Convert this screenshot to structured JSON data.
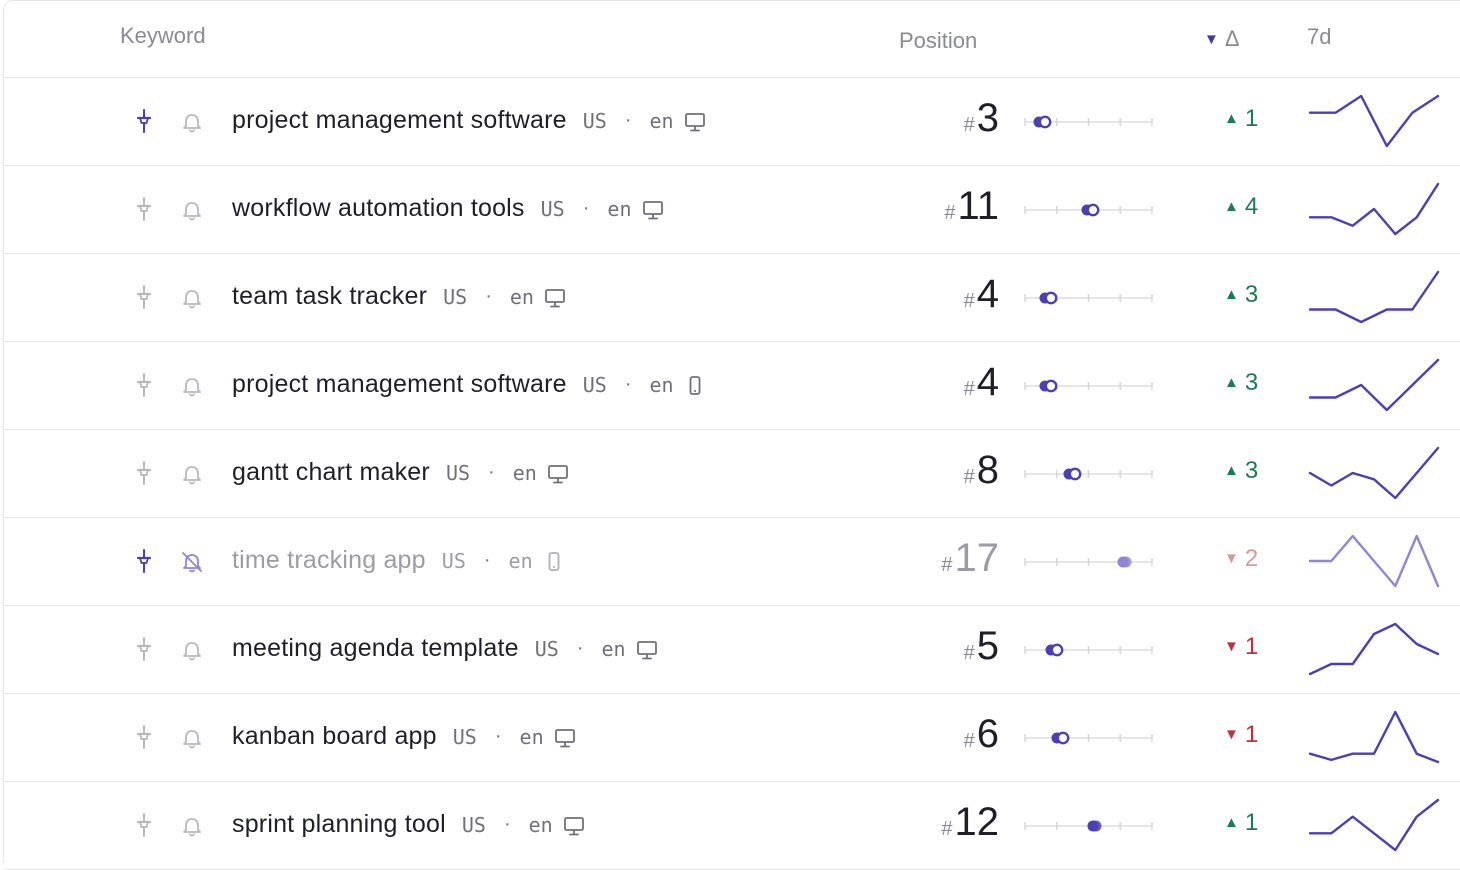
{
  "header": {
    "keyword": "Keyword",
    "position": "Position",
    "delta_sort_icon": "▼",
    "delta": "Δ",
    "trend": "7d"
  },
  "colors": {
    "accent": "#4b3fb5",
    "accent_light": "#8f86d6",
    "up": "#1e7a54",
    "down": "#c0313b",
    "down_light": "#d69a9e",
    "muted": "#b8b8c0"
  },
  "rows": [
    {
      "keyword": "project management software",
      "country": "US",
      "dot": "·",
      "lang": "en",
      "device": "desktop-icon",
      "hash": "#",
      "position": "3",
      "delta_dir": "up",
      "delta_arrow": "▲",
      "delta": "1",
      "pinned": true,
      "alert": "on",
      "dim": false,
      "range_markers": [
        3,
        4
      ],
      "trend": [
        4,
        4,
        3,
        6,
        4,
        3
      ]
    },
    {
      "keyword": "workflow automation tools",
      "country": "US",
      "dot": "·",
      "lang": "en",
      "device": "desktop-icon",
      "hash": "#",
      "position": "11",
      "delta_dir": "up",
      "delta_arrow": "▲",
      "delta": "4",
      "pinned": false,
      "alert": "off",
      "dim": false,
      "range_markers": [
        11,
        12
      ],
      "trend": [
        15,
        15,
        16,
        14,
        17,
        15,
        11
      ]
    },
    {
      "keyword": "team task tracker",
      "country": "US",
      "dot": "·",
      "lang": "en",
      "device": "desktop-icon",
      "hash": "#",
      "position": "4",
      "delta_dir": "up",
      "delta_arrow": "▲",
      "delta": "3",
      "pinned": false,
      "alert": "off",
      "dim": false,
      "range_markers": [
        4,
        5
      ],
      "trend": [
        7,
        7,
        8,
        7,
        7,
        4
      ]
    },
    {
      "keyword": "project management software",
      "country": "US",
      "dot": "·",
      "lang": "en",
      "device": "mobile-icon",
      "hash": "#",
      "position": "4",
      "delta_dir": "up",
      "delta_arrow": "▲",
      "delta": "3",
      "pinned": false,
      "alert": "off",
      "dim": false,
      "range_markers": [
        4,
        5
      ],
      "trend": [
        7,
        7,
        6,
        8,
        6,
        4
      ]
    },
    {
      "keyword": "gantt chart maker",
      "country": "US",
      "dot": "·",
      "lang": "en",
      "device": "desktop-icon",
      "hash": "#",
      "position": "8",
      "delta_dir": "up",
      "delta_arrow": "▲",
      "delta": "3",
      "pinned": false,
      "alert": "off",
      "dim": false,
      "range_markers": [
        8,
        9
      ],
      "trend": [
        10,
        11,
        10,
        10.5,
        12,
        10,
        8
      ]
    },
    {
      "keyword": "time tracking app",
      "country": "US",
      "dot": "·",
      "lang": "en",
      "device": "mobile-icon",
      "hash": "#",
      "position": "17",
      "delta_dir": "down",
      "delta_arrow": "▼",
      "delta": "2",
      "pinned": true,
      "alert": "muted",
      "dim": true,
      "range_markers": [
        17,
        17
      ],
      "trend": [
        16,
        16,
        14,
        16,
        18,
        14,
        18
      ]
    },
    {
      "keyword": "meeting agenda template",
      "country": "US",
      "dot": "·",
      "lang": "en",
      "device": "desktop-icon",
      "hash": "#",
      "position": "5",
      "delta_dir": "down",
      "delta_arrow": "▼",
      "delta": "1",
      "pinned": false,
      "alert": "off",
      "dim": false,
      "range_markers": [
        5,
        6
      ],
      "trend": [
        7,
        6.5,
        6.5,
        5,
        4.5,
        5.5,
        6
      ]
    },
    {
      "keyword": "kanban board app",
      "country": "US",
      "dot": "·",
      "lang": "en",
      "device": "desktop-icon",
      "hash": "#",
      "position": "6",
      "delta_dir": "down",
      "delta_arrow": "▼",
      "delta": "1",
      "pinned": false,
      "alert": "off",
      "dim": false,
      "range_markers": [
        6,
        7
      ],
      "trend": [
        7,
        7.3,
        7,
        7,
        5,
        7,
        7.4
      ]
    },
    {
      "keyword": "sprint planning tool",
      "country": "US",
      "dot": "·",
      "lang": "en",
      "device": "desktop-icon",
      "hash": "#",
      "position": "12",
      "delta_dir": "up",
      "delta_arrow": "▲",
      "delta": "1",
      "pinned": false,
      "alert": "off",
      "dim": false,
      "range_markers": [
        12,
        12
      ],
      "trend": [
        13,
        13,
        12,
        13,
        14,
        12,
        11
      ]
    }
  ]
}
